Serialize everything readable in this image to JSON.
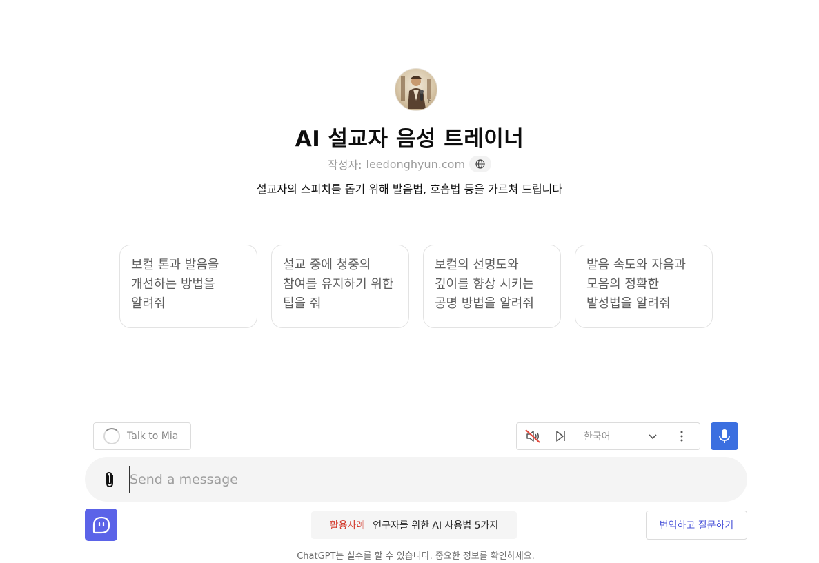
{
  "gpt": {
    "title": "AI 설교자 음성 트레이너",
    "author_prefix": "작성자:",
    "author": "leedonghyun.com",
    "description": "설교자의 스피치를 돕기 위해 발음법, 호흡법 등을 가르쳐 드립니다"
  },
  "conversation_starters": [
    {
      "label": "보컬 톤과 발음을 개선하는 방법을 알려줘"
    },
    {
      "label": "설교 중에 청중의 참여를 유지하기 위한 팁을 줘"
    },
    {
      "label": "보컬의 선명도와 깊이를 향상 시키는 공명 방법을 알려줘"
    },
    {
      "label": "발음 속도와 자음과 모음의 정확한 발성법을 알려줘"
    }
  ],
  "voice_controls": {
    "talk_label": "Talk to Mia",
    "language": "한국어"
  },
  "composer": {
    "placeholder": "Send a message"
  },
  "promo": {
    "tag": "활용사례",
    "text": "연구자를 위한 AI 사용법 5가지"
  },
  "translate_button": "번역하고 질문하기",
  "disclaimer": "ChatGPT는 실수를 할 수 있습니다. 중요한 정보를 확인하세요.",
  "colors": {
    "mic_button": "#3b6fe0",
    "bot_button": "#5b63e8",
    "promo_tag": "#d33a2c",
    "translate_text": "#4b55d9"
  }
}
